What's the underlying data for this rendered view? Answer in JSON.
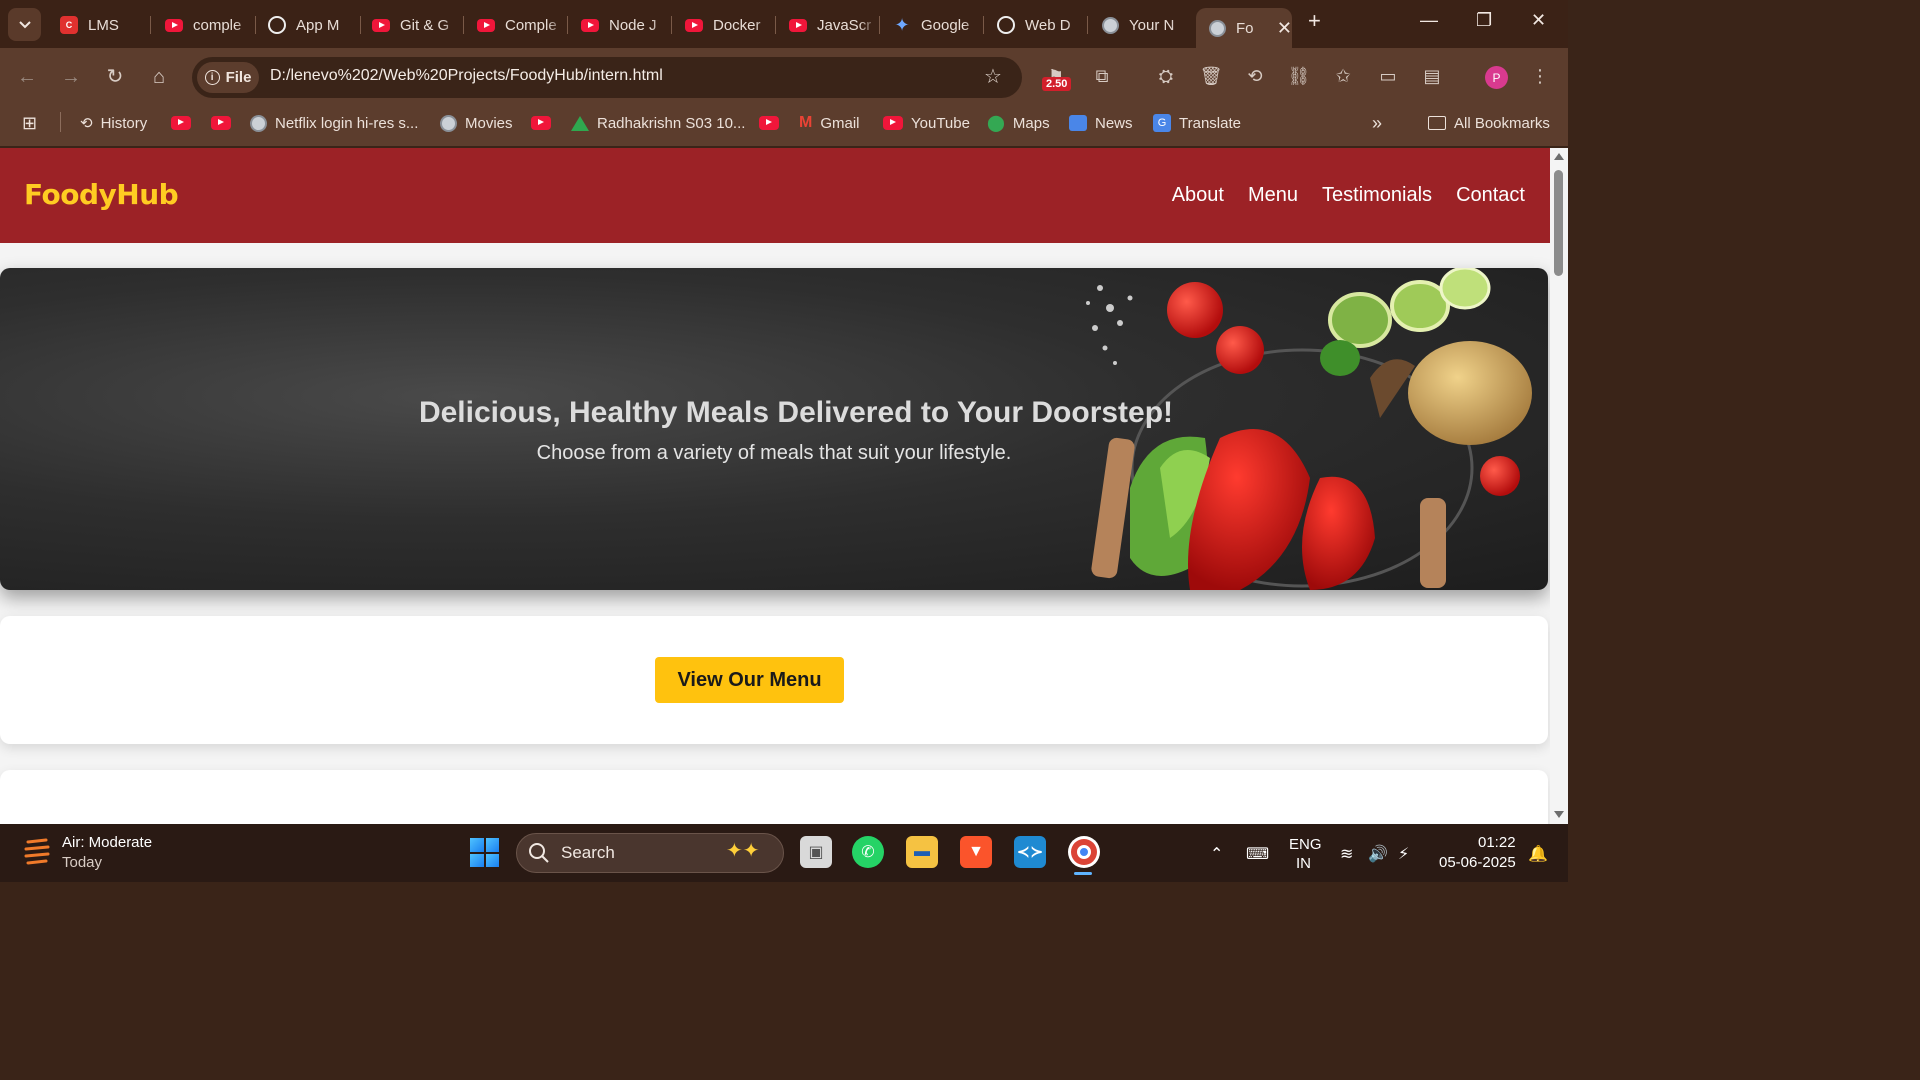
{
  "browser": {
    "tabs": [
      {
        "title": "LMS",
        "icon": "lms-icon"
      },
      {
        "title": "comple",
        "icon": "youtube-icon"
      },
      {
        "title": "App M",
        "icon": "openai-icon"
      },
      {
        "title": "Git & G",
        "icon": "youtube-icon"
      },
      {
        "title": "Comple",
        "icon": "youtube-icon"
      },
      {
        "title": "Node J",
        "icon": "youtube-icon"
      },
      {
        "title": "Docker",
        "icon": "youtube-icon"
      },
      {
        "title": "JavaScr",
        "icon": "youtube-icon"
      },
      {
        "title": "Google",
        "icon": "gemini-icon"
      },
      {
        "title": "Web D",
        "icon": "openai-icon"
      },
      {
        "title": "Your N",
        "icon": "globe-icon"
      },
      {
        "title": "Fo",
        "icon": "globe-icon"
      }
    ],
    "address": {
      "chip_label": "File",
      "url": "D:/lenevo%202/Web%20Projects/FoodyHub/intern.html"
    },
    "extension_badge": "2.50",
    "profile_initial": "P",
    "bookmarks": [
      {
        "label": "History",
        "icon": "history-icon"
      },
      {
        "label": "",
        "icon": "youtube-icon"
      },
      {
        "label": "",
        "icon": "youtube-icon"
      },
      {
        "label": "Netflix login hi-res s...",
        "icon": "globe-icon"
      },
      {
        "label": "Movies",
        "icon": "globe-icon"
      },
      {
        "label": "",
        "icon": "youtube-icon"
      },
      {
        "label": "Radhakrishn S03 10...",
        "icon": "drive-icon"
      },
      {
        "label": "",
        "icon": "youtube-icon"
      },
      {
        "label": "Gmail",
        "icon": "gmail-icon"
      },
      {
        "label": "YouTube",
        "icon": "youtube-icon"
      },
      {
        "label": "Maps",
        "icon": "maps-icon"
      },
      {
        "label": "News",
        "icon": "news-icon"
      },
      {
        "label": "Translate",
        "icon": "translate-icon"
      }
    ],
    "all_bookmarks": "All Bookmarks",
    "overflow": "»"
  },
  "site": {
    "brand": "FoodyHub",
    "brand_color": "#ffcc22",
    "header_color": "#9c2226",
    "nav": [
      "About",
      "Menu",
      "Testimonials",
      "Contact"
    ],
    "hero": {
      "title": "Delicious, Healthy Meals Delivered to Your Doorstep!",
      "subtitle": "Choose from a variety of meals that suit your lifestyle."
    },
    "cta": {
      "label": "View Our Menu",
      "color": "#ffc20e"
    }
  },
  "taskbar": {
    "weather": {
      "title": "Air: Moderate",
      "subtitle": "Today"
    },
    "search_label": "Search",
    "language": {
      "line1": "ENG",
      "line2": "IN"
    },
    "clock": {
      "time": "01:22",
      "date": "05-06-2025"
    }
  }
}
